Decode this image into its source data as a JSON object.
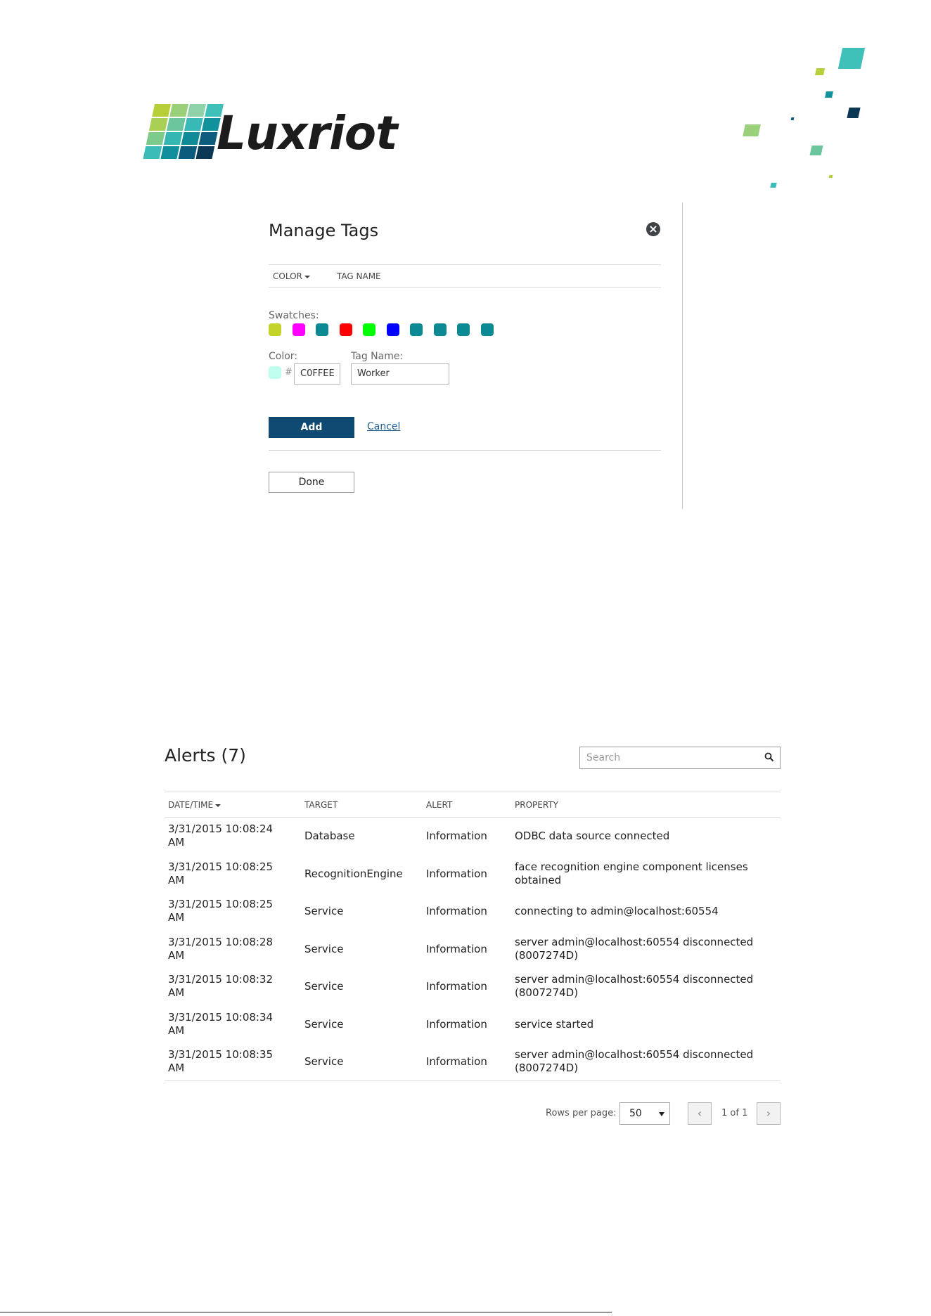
{
  "logo": {
    "text": "Luxriot"
  },
  "manage_tags": {
    "title": "Manage Tags",
    "columns": {
      "color": "COLOR",
      "tag_name": "TAG NAME"
    },
    "swatches_label": "Swatches:",
    "swatches": [
      "#c3d32a",
      "#ff00ff",
      "#0b8a94",
      "#ff0000",
      "#00ff00",
      "#0000ff",
      "#0b8a94",
      "#0b8a94",
      "#0b8a94",
      "#0b8a94"
    ],
    "color_label": "Color:",
    "hash": "#",
    "color_value": "C0FFEE",
    "tag_name_label": "Tag Name:",
    "tag_name_value": "Worker",
    "add_label": "Add",
    "cancel_label": "Cancel",
    "done_label": "Done"
  },
  "alerts": {
    "title": "Alerts (7)",
    "search_placeholder": "Search",
    "columns": {
      "datetime": "DATE/TIME",
      "target": "TARGET",
      "alert": "ALERT",
      "property": "PROPERTY"
    },
    "rows": [
      {
        "date": "3/31/2015 10:08:24",
        "ampm": "AM",
        "target": "Database",
        "alert": "Information",
        "property_line1": "ODBC data source connected",
        "property_line2": ""
      },
      {
        "date": "3/31/2015 10:08:25",
        "ampm": "AM",
        "target": "RecognitionEngine",
        "alert": "Information",
        "property_line1": "face recognition engine component licenses",
        "property_line2": "obtained"
      },
      {
        "date": "3/31/2015 10:08:25",
        "ampm": "AM",
        "target": "Service",
        "alert": "Information",
        "property_line1": "connecting to admin@localhost:60554",
        "property_line2": ""
      },
      {
        "date": "3/31/2015 10:08:28",
        "ampm": "AM",
        "target": "Service",
        "alert": "Information",
        "property_line1": "server admin@localhost:60554 disconnected",
        "property_line2": "(8007274D)"
      },
      {
        "date": "3/31/2015 10:08:32",
        "ampm": "AM",
        "target": "Service",
        "alert": "Information",
        "property_line1": "server admin@localhost:60554 disconnected",
        "property_line2": "(8007274D)"
      },
      {
        "date": "3/31/2015 10:08:34",
        "ampm": "AM",
        "target": "Service",
        "alert": "Information",
        "property_line1": "service started",
        "property_line2": ""
      },
      {
        "date": "3/31/2015 10:08:35",
        "ampm": "AM",
        "target": "Service",
        "alert": "Information",
        "property_line1": "server admin@localhost:60554 disconnected",
        "property_line2": "(8007274D)"
      }
    ],
    "rows_per_page_label": "Rows per page:",
    "rows_per_page_value": "50",
    "pagination_text": "1 of 1"
  }
}
